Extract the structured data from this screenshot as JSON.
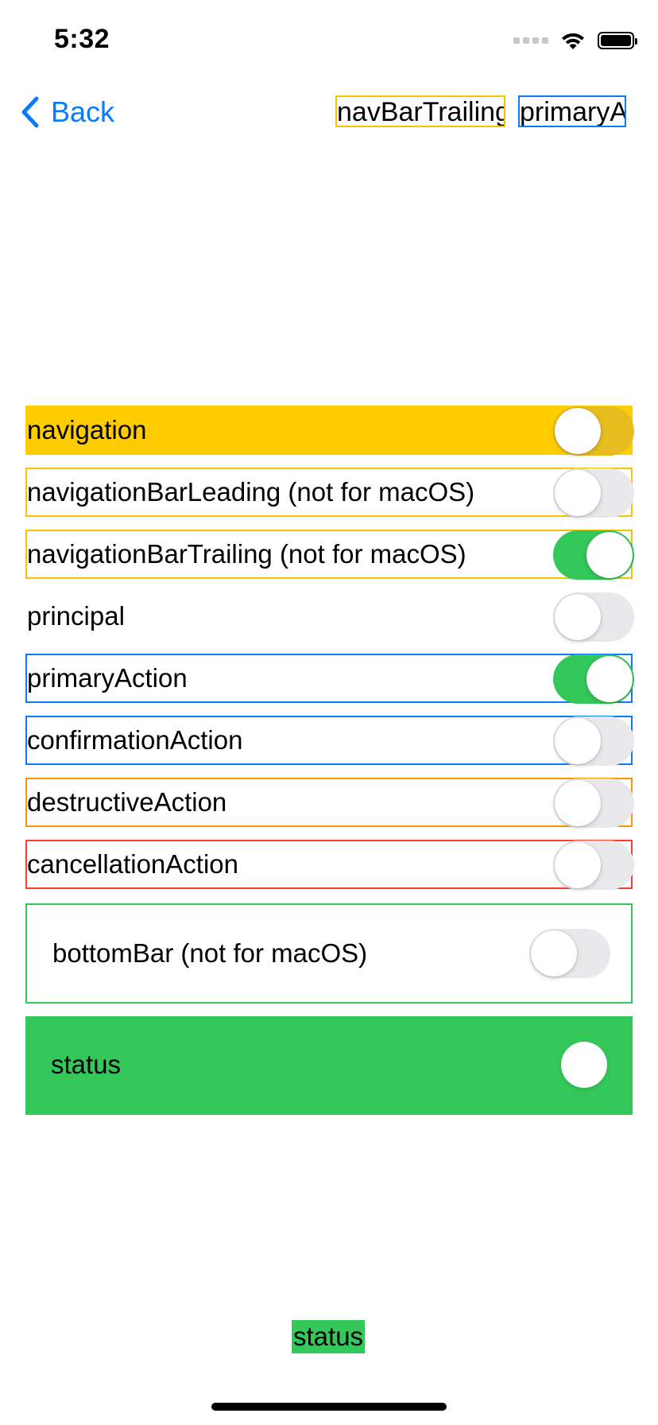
{
  "status_bar": {
    "time": "5:32",
    "icons": [
      "cellular-signal-icon",
      "wifi-icon",
      "battery-icon"
    ]
  },
  "nav": {
    "back_label": "Back",
    "trailing_items": [
      "navBarTrailing",
      "primaryA"
    ]
  },
  "rows": [
    {
      "label": "navigation",
      "on": false,
      "style": "yellow-fill"
    },
    {
      "label": "navigationBarLeading (not for macOS)",
      "on": false,
      "style": "yellow-border"
    },
    {
      "label": "navigationBarTrailing (not for macOS)",
      "on": true,
      "style": "yellow-border"
    },
    {
      "label": "principal",
      "on": false,
      "style": "none"
    },
    {
      "label": "primaryAction",
      "on": true,
      "style": "blue-border"
    },
    {
      "label": "confirmationAction",
      "on": false,
      "style": "blue-border"
    },
    {
      "label": "destructiveAction",
      "on": false,
      "style": "orange-border"
    },
    {
      "label": "cancellationAction",
      "on": false,
      "style": "red-border"
    }
  ],
  "bottom_bar_row": {
    "label": "bottomBar (not for macOS)",
    "on": false
  },
  "status_row": {
    "label": "status",
    "on": true
  },
  "bottom_status_label": "status",
  "colors": {
    "accent_blue": "#0a7aff",
    "yellow": "#ffcc00",
    "green": "#34c759",
    "orange": "#ff9500",
    "red": "#ff3b30"
  }
}
